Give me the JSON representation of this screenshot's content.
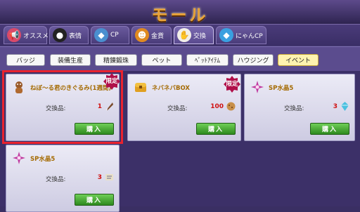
{
  "window": {
    "title": "モール"
  },
  "tabs": [
    {
      "label": "オススメ",
      "icon": "megaphone-icon",
      "color": "#d94a6a"
    },
    {
      "label": "表情",
      "icon": "face-icon",
      "color": "#222222"
    },
    {
      "label": "CP",
      "icon": "cp-diamond-icon",
      "color": "#4a8fcf"
    },
    {
      "label": "金貨",
      "icon": "coin-icon",
      "color": "#e08a20"
    },
    {
      "label": "交換",
      "icon": "exchange-icon",
      "color": "#e0a040",
      "active": true
    },
    {
      "label": "にゃんCP",
      "icon": "cat-cp-icon",
      "color": "#3aa0e0"
    }
  ],
  "filters": [
    {
      "label": "バッジ"
    },
    {
      "label": "装備生産"
    },
    {
      "label": "精錬鍛珠"
    },
    {
      "label": "ペット"
    },
    {
      "label": "ﾍﾟｯﾄｱｲﾃﾑ"
    },
    {
      "label": "ハウジング"
    },
    {
      "label": "イベント",
      "active": true
    }
  ],
  "items": [
    {
      "name": "ねぼ〜る君のきぐるみ(1週間)",
      "exchange_label": "交換品:",
      "quantity": "1",
      "limited": true,
      "limited_label": "限定",
      "buy_label": "購入",
      "icon": "mascot-suit-icon",
      "cost_icon": "feather-icon",
      "highlighted": true
    },
    {
      "name": "ネバネバBOX",
      "exchange_label": "交換品:",
      "quantity": "100",
      "limited": true,
      "limited_label": "限定",
      "buy_label": "購入",
      "icon": "treasure-box-icon",
      "cost_icon": "cookie-icon"
    },
    {
      "name": "SP水晶5",
      "exchange_label": "交換品:",
      "quantity": "3",
      "limited": false,
      "buy_label": "購入",
      "icon": "sp-crystal-icon",
      "cost_icon": "crystal-cost-icon"
    },
    {
      "name": "SP水晶5",
      "exchange_label": "交換品:",
      "quantity": "3",
      "limited": false,
      "buy_label": "購入",
      "icon": "sp-crystal-icon",
      "cost_icon": "scroll-icon"
    }
  ]
}
